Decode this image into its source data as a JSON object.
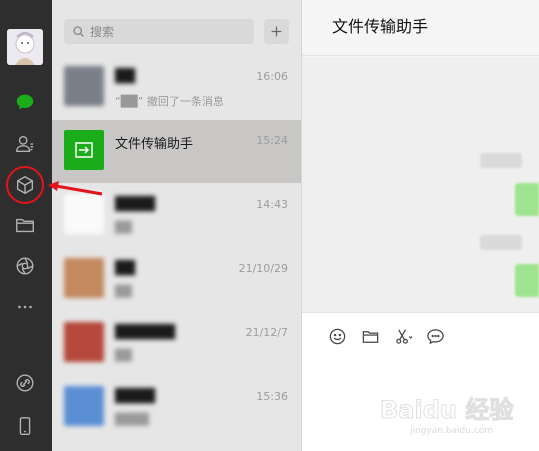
{
  "sidebar": {
    "icons": [
      "avatar",
      "chat-icon",
      "contacts-icon",
      "mini-program-icon",
      "folder-icon",
      "moments-icon",
      "more-icon",
      "settings-link-icon",
      "phone-icon"
    ],
    "active_color": "#1aad19"
  },
  "search": {
    "placeholder": "搜索"
  },
  "add_button": {
    "icon": "plus-icon"
  },
  "conversations": [
    {
      "name": "██",
      "time": "16:06",
      "preview": "“██” 撤回了一条消息",
      "blurred": true
    },
    {
      "name": "文件传输助手",
      "time": "15:24",
      "preview": "",
      "blurred": false,
      "selected": true
    },
    {
      "name": "████",
      "time": "14:43",
      "preview": "██",
      "blurred": true
    },
    {
      "name": "██",
      "time": "21/10/29",
      "preview": "██",
      "blurred": true
    },
    {
      "name": "██████",
      "time": "21/12/7",
      "preview": "██",
      "blurred": true
    },
    {
      "name": "████",
      "time": "15:36",
      "preview": "████",
      "blurred": true
    }
  ],
  "chat": {
    "title": "文件传输助手",
    "toolbar": [
      "emoji-icon",
      "folder-icon",
      "scissors-icon",
      "comment-icon"
    ]
  },
  "watermark": {
    "brand": "Baidu 经验",
    "url": "jingyan.baidu.com"
  },
  "colors": {
    "rail": "#2e2e2e",
    "list": "#e6e6e6",
    "selected": "#c9c7c6",
    "green": "#1aad19",
    "annotation": "#e4141b"
  }
}
